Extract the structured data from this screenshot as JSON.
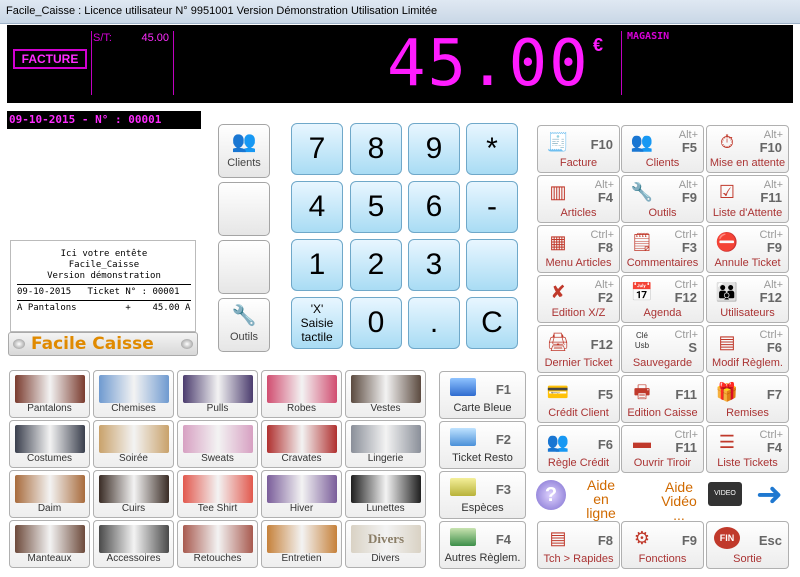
{
  "window": {
    "title": "Facile_Caisse : Licence utilisateur N° 9951001 Version Démonstration Utilisation Limitée"
  },
  "display": {
    "facture_label": "FACTURE",
    "subtotal_label": "S/T:",
    "subtotal_value": "45.00",
    "total": "45.00",
    "currency": "€",
    "magasin_label": "MAGASIN",
    "accent_color": "#ff1cff"
  },
  "date_line": "09-10-2015 - N° : 00001",
  "ticket": {
    "header1": "Ici votre entête",
    "header2": "Facile_Caisse",
    "header3": "Version démonstration",
    "line_date": "09-10-2015   Ticket N° : 00001",
    "line_item": "A Pantalons         +    45.00 A"
  },
  "logo": {
    "text": "Facile Caisse"
  },
  "side_buttons": {
    "clients": "Clients",
    "outils": "Outils"
  },
  "keypad": {
    "k7": "7",
    "k8": "8",
    "k9": "9",
    "kstar": "*",
    "k4": "4",
    "k5": "5",
    "k6": "6",
    "kminus": "-",
    "k1": "1",
    "k2": "2",
    "k3": "3",
    "kx_line1": "'X'",
    "kx_line2": "Saisie",
    "kx_line3": "tactile",
    "k0": "0",
    "kdot": ".",
    "kc": "C"
  },
  "functions": {
    "facture": {
      "mod": "",
      "key": "F10",
      "label": "Facture",
      "icon": "invoice-icon"
    },
    "clients": {
      "mod": "Alt+",
      "key": "F5",
      "label": "Clients",
      "icon": "people-icon"
    },
    "attente": {
      "mod": "Alt+",
      "key": "F10",
      "label": "Mise en attente",
      "icon": "stopwatch-icon"
    },
    "articles": {
      "mod": "Alt+",
      "key": "F4",
      "label": "Articles",
      "icon": "barcode-icon"
    },
    "outils": {
      "mod": "Alt+",
      "key": "F9",
      "label": "Outils",
      "icon": "tools-icon"
    },
    "liste_attente": {
      "mod": "Alt+",
      "key": "F11",
      "label": "Liste d'Attente",
      "icon": "checklist-icon"
    },
    "menu_articles": {
      "mod": "Ctrl+",
      "key": "F8",
      "label": "Menu Articles",
      "icon": "grid-icon"
    },
    "commentaires": {
      "mod": "Ctrl+",
      "key": "F3",
      "label": "Commentaires",
      "icon": "note-icon"
    },
    "annule": {
      "mod": "Ctrl+",
      "key": "F9",
      "label": "Annule Ticket",
      "icon": "cancel-icon"
    },
    "edition_xz": {
      "mod": "Alt+",
      "key": "F2",
      "label": "Edition X/Z",
      "icon": "report-icon"
    },
    "agenda": {
      "mod": "Ctrl+",
      "key": "F12",
      "label": "Agenda",
      "icon": "calendar-icon"
    },
    "utilisateurs": {
      "mod": "Alt+",
      "key": "F12",
      "label": "Utilisateurs",
      "icon": "users-icon"
    },
    "dernier_ticket": {
      "mod": "",
      "key": "F12",
      "label": "Dernier Ticket",
      "icon": "receipt-icon"
    },
    "sauvegarde": {
      "mod": "Ctrl+",
      "key": "S",
      "label": "Sauvegarde",
      "icon": "usb-icon",
      "icon_text1": "Clé",
      "icon_text2": "Usb"
    },
    "modif_reglem": {
      "mod": "Ctrl+",
      "key": "F6",
      "label": "Modif Règlem.",
      "icon": "calculator-icon"
    },
    "credit_client": {
      "mod": "",
      "key": "F5",
      "label": "Crédit Client",
      "icon": "credit-icon"
    },
    "edition_caisse": {
      "mod": "",
      "key": "F11",
      "label": "Edition Caisse",
      "icon": "printer-icon"
    },
    "remises": {
      "mod": "",
      "key": "F7",
      "label": "Remises",
      "icon": "gift-icon"
    },
    "regle_credit": {
      "mod": "",
      "key": "F6",
      "label": "Règle Crédit",
      "icon": "people-pay-icon"
    },
    "ouvrir_tiroir": {
      "mod": "Ctrl+",
      "key": "F11",
      "label": "Ouvrir Tiroir",
      "icon": "drawer-icon"
    },
    "liste_tickets": {
      "mod": "Ctrl+",
      "key": "F4",
      "label": "Liste Tickets",
      "icon": "list-icon"
    },
    "tch_rapides": {
      "mod": "",
      "key": "F8",
      "label": "Tch > Rapides",
      "icon": "quickkeys-icon"
    },
    "fonctions": {
      "mod": "",
      "key": "F9",
      "label": "Fonctions",
      "icon": "functions-icon"
    },
    "sortie": {
      "mod": "",
      "key": "Esc",
      "label": "Sortie",
      "icon": "exit-icon",
      "icon_text": "FIN"
    }
  },
  "payments": {
    "carte": {
      "key": "F1",
      "label": "Carte Bleue",
      "icon": "card-icon"
    },
    "resto": {
      "key": "F2",
      "label": "Ticket Resto",
      "icon": "voucher-icon"
    },
    "especes": {
      "key": "F3",
      "label": "Espèces",
      "icon": "cash-icon"
    },
    "autres": {
      "key": "F4",
      "label": "Autres Règlem.",
      "icon": "payments-icon"
    }
  },
  "categories": [
    {
      "label": "Pantalons",
      "color": "#7a3b2e"
    },
    {
      "label": "Chemises",
      "color": "#6f9ad0"
    },
    {
      "label": "Pulls",
      "color": "#4b3c6e"
    },
    {
      "label": "Robes",
      "color": "#d14d70"
    },
    {
      "label": "Vestes",
      "color": "#5b4a3f"
    },
    {
      "label": "Costumes",
      "color": "#3a3f4d"
    },
    {
      "label": "Soirée",
      "color": "#c9a26b"
    },
    {
      "label": "Sweats",
      "color": "#d7a0c2"
    },
    {
      "label": "Cravates",
      "color": "#b0302f"
    },
    {
      "label": "Lingerie",
      "color": "#8a8f99"
    },
    {
      "label": "Daim",
      "color": "#a86b3c"
    },
    {
      "label": "Cuirs",
      "color": "#3a2c25"
    },
    {
      "label": "Tee Shirt",
      "color": "#e2594e"
    },
    {
      "label": "Hiver",
      "color": "#7a5d9a"
    },
    {
      "label": "Lunettes",
      "color": "#1f1f1f"
    },
    {
      "label": "Manteaux",
      "color": "#6d4a3b"
    },
    {
      "label": "Accessoires",
      "color": "#4a4a4a"
    },
    {
      "label": "Retouches",
      "color": "#a85a4f"
    },
    {
      "label": "Entretien",
      "color": "#c6813a"
    },
    {
      "label": "Divers",
      "color": "#d9d2c4",
      "img_text": "Divers"
    }
  ],
  "help": {
    "aide_ligne_1": "Aide en",
    "aide_ligne_2": "ligne",
    "aide_video_1": "Aide",
    "aide_video_2": "Vidéo ...",
    "video_text": "VIDEO"
  }
}
